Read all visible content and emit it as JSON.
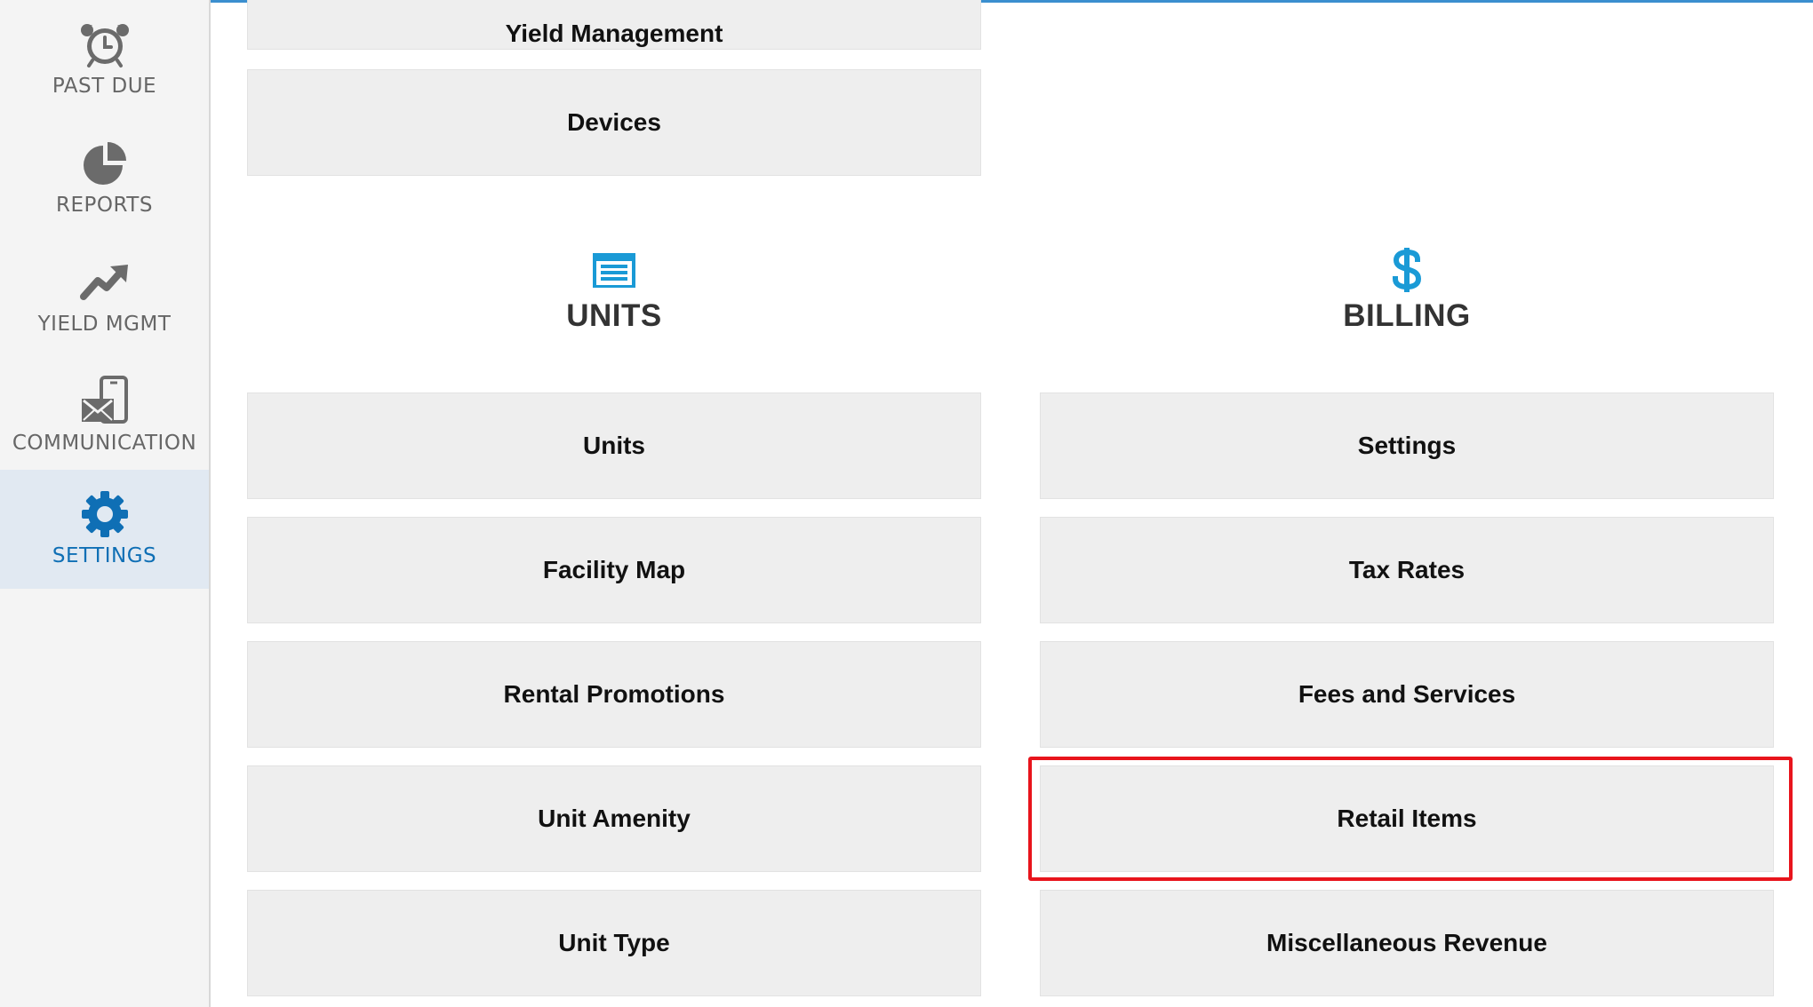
{
  "sidebar": {
    "items": [
      {
        "label": "PAST DUE",
        "icon": "alarm-clock-icon"
      },
      {
        "label": "REPORTS",
        "icon": "pie-chart-icon"
      },
      {
        "label": "YIELD MGMT",
        "icon": "trend-up-icon"
      },
      {
        "label": "COMMUNICATION",
        "icon": "phone-mail-icon"
      },
      {
        "label": "SETTINGS",
        "icon": "gear-icon",
        "active": true
      }
    ]
  },
  "main": {
    "top_tiles": [
      {
        "label": "Yield Management"
      },
      {
        "label": "Devices"
      }
    ],
    "sections": [
      {
        "title": "UNITS",
        "icon": "storage-unit-icon",
        "items": [
          "Units",
          "Facility Map",
          "Rental Promotions",
          "Unit Amenity",
          "Unit Type"
        ]
      },
      {
        "title": "BILLING",
        "icon": "dollar-icon",
        "items": [
          "Settings",
          "Tax Rates",
          "Fees and Services",
          "Retail Items",
          "Miscellaneous Revenue"
        ]
      }
    ],
    "highlighted_item": "Retail Items"
  },
  "colors": {
    "accent": "#0f6fb5",
    "icon_blue": "#1a9ad6",
    "highlight": "#e8141c",
    "tile_bg": "#eeeeee",
    "sidebar_bg": "#f4f4f4"
  }
}
